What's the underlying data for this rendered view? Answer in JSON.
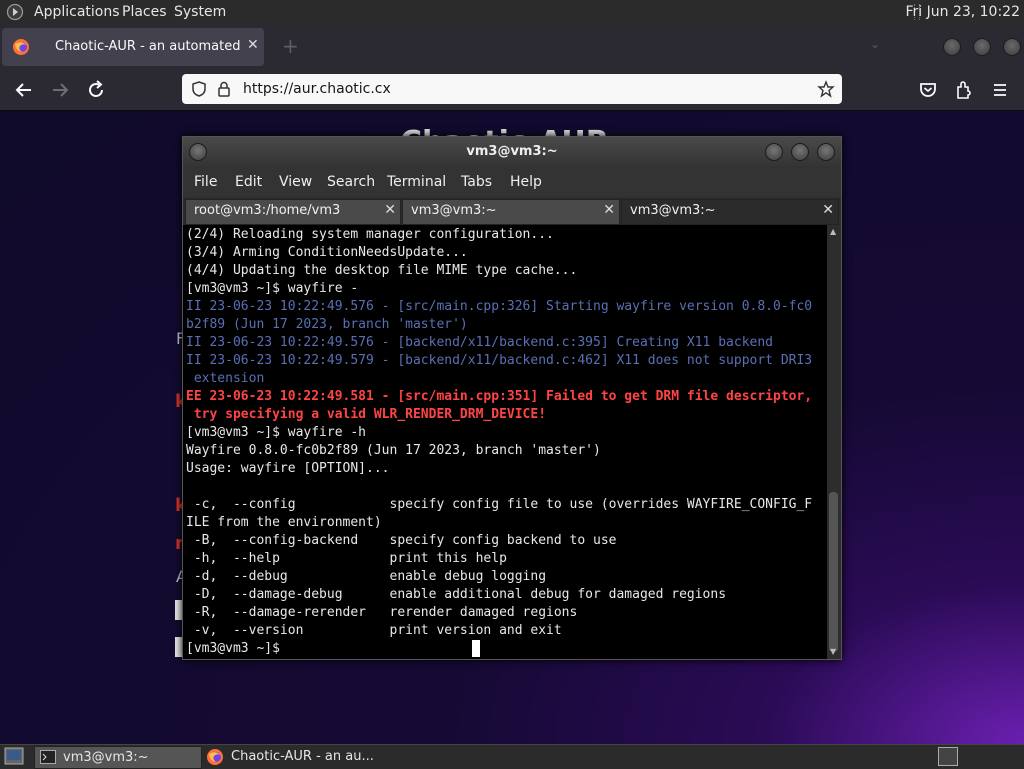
{
  "top_panel": {
    "menus": [
      "Applications",
      "Places",
      "System"
    ],
    "clock": "Fri Jun 23, 10:22"
  },
  "browser": {
    "tab_title": "Chaotic-AUR - an automated bu",
    "url": "https://aur.chaotic.cx"
  },
  "page_fragments": {
    "heading_partial": "Chaotic-AUR",
    "left_chars": [
      "F",
      "k",
      "k",
      "n",
      "A"
    ]
  },
  "terminal": {
    "title": "vm3@vm3:~",
    "menu": [
      "File",
      "Edit",
      "View",
      "Search",
      "Terminal",
      "Tabs",
      "Help"
    ],
    "tabs": [
      "root@vm3:/home/vm3",
      "vm3@vm3:~",
      "vm3@vm3:~"
    ],
    "lines": [
      {
        "text": "(2/4) Reloading system manager configuration...",
        "style": "normal"
      },
      {
        "text": "(3/4) Arming ConditionNeedsUpdate...",
        "style": "normal"
      },
      {
        "text": "(4/4) Updating the desktop file MIME type cache...",
        "style": "normal"
      },
      {
        "text": "[vm3@vm3 ~]$ wayfire -",
        "style": "normal"
      },
      {
        "text": "II 23-06-23 10:22:49.576 - [src/main.cpp:326] Starting wayfire version 0.8.0-fc0",
        "style": "blue"
      },
      {
        "text": "b2f89 (Jun 17 2023, branch 'master')",
        "style": "blue"
      },
      {
        "text": "II 23-06-23 10:22:49.576 - [backend/x11/backend.c:395] Creating X11 backend",
        "style": "blue"
      },
      {
        "text": "II 23-06-23 10:22:49.579 - [backend/x11/backend.c:462] X11 does not support DRI3",
        "style": "blue"
      },
      {
        "text": " extension",
        "style": "blue"
      },
      {
        "text": "EE 23-06-23 10:22:49.581 - [src/main.cpp:351] Failed to get DRM file descriptor,",
        "style": "red"
      },
      {
        "text": " try specifying a valid WLR_RENDER_DRM_DEVICE!",
        "style": "red"
      },
      {
        "text": "[vm3@vm3 ~]$ wayfire -h",
        "style": "normal"
      },
      {
        "text": "Wayfire 0.8.0-fc0b2f89 (Jun 17 2023, branch 'master')",
        "style": "normal"
      },
      {
        "text": "Usage: wayfire [OPTION]...",
        "style": "normal"
      },
      {
        "text": "",
        "style": "normal"
      },
      {
        "text": " -c,  --config            specify config file to use (overrides WAYFIRE_CONFIG_F",
        "style": "normal"
      },
      {
        "text": "ILE from the environment)",
        "style": "normal"
      },
      {
        "text": " -B,  --config-backend    specify config backend to use",
        "style": "normal"
      },
      {
        "text": " -h,  --help              print this help",
        "style": "normal"
      },
      {
        "text": " -d,  --debug             enable debug logging",
        "style": "normal"
      },
      {
        "text": " -D,  --damage-debug      enable additional debug for damaged regions",
        "style": "normal"
      },
      {
        "text": " -R,  --damage-rerender   rerender damaged regions",
        "style": "normal"
      },
      {
        "text": " -v,  --version           print version and exit",
        "style": "normal"
      },
      {
        "text": "[vm3@vm3 ~]$ ",
        "style": "normal"
      }
    ]
  },
  "taskbar": {
    "tasks": [
      "vm3@vm3:~",
      "Chaotic-AUR - an au..."
    ]
  },
  "colors": {
    "panel_bg": "#2b2b2b",
    "browser_chrome": "#2b2a33",
    "log_info": "#5a6fb4",
    "log_error": "#ff4444",
    "page_bg": "#150a34"
  }
}
